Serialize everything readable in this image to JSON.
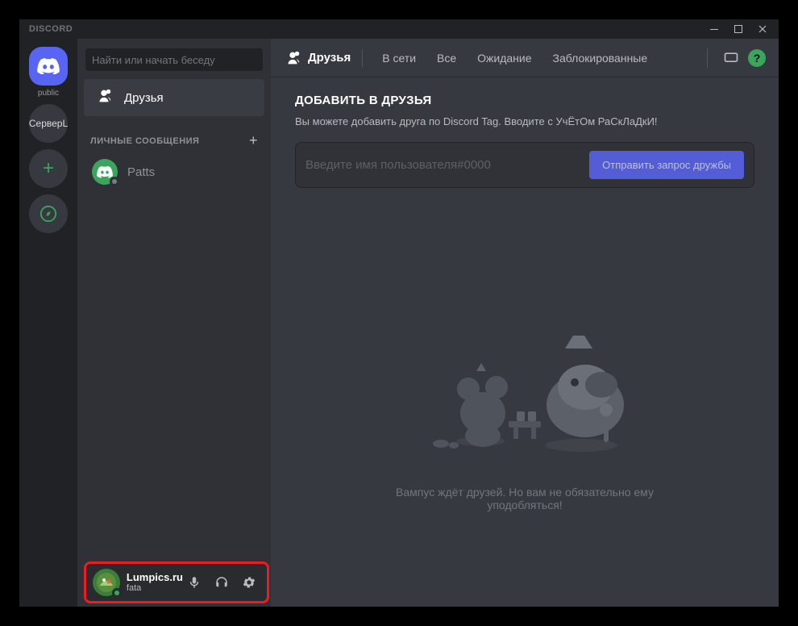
{
  "window": {
    "title": "DISCORD"
  },
  "servers": {
    "public_label": "public",
    "server_l": "СерверL"
  },
  "sidebar": {
    "search_placeholder": "Найти или начать беседу",
    "friends_label": "Друзья",
    "dm_header": "ЛИЧНЫЕ СООБЩЕНИЯ",
    "dms": [
      {
        "name": "Patts"
      }
    ]
  },
  "user_panel": {
    "username": "Lumpics.ru",
    "status": "fata"
  },
  "top": {
    "friends_label": "Друзья",
    "tabs": {
      "online": "В сети",
      "all": "Все",
      "pending": "Ожидание",
      "blocked": "Заблокированные"
    }
  },
  "add_friend": {
    "title": "ДОБАВИТЬ В ДРУЗЬЯ",
    "subtitle": "Вы можете добавить друга по Discord Tag. Вводите с УчЁтОм РаСкЛаДкИ!",
    "input_placeholder": "Введите имя пользователя#0000",
    "button_label": "Отправить запрос дружбы"
  },
  "empty_state": {
    "line1": "Вампус ждёт друзей. Но вам не обязательно ему",
    "line2": "уподобляться!"
  }
}
